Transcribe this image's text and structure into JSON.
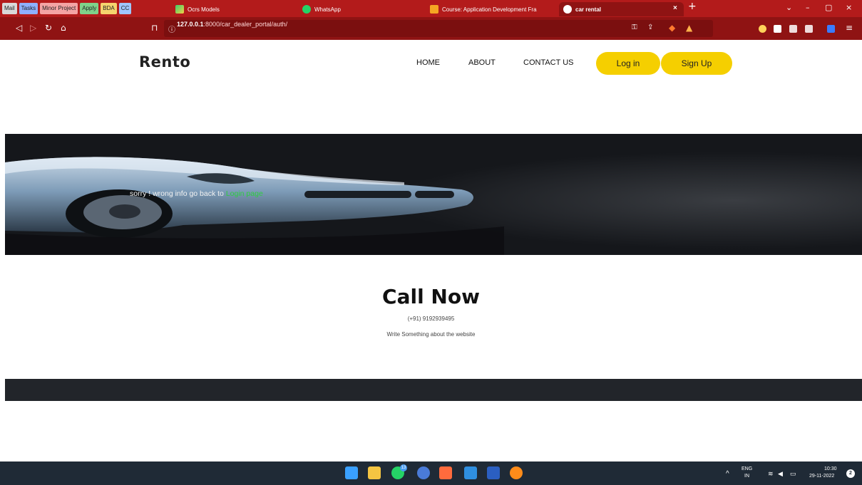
{
  "browser": {
    "bookmarks": [
      {
        "label": "Mail",
        "color": "#d9d9d9"
      },
      {
        "label": "Tasks",
        "color": "#8fb0ff"
      },
      {
        "label": "Minor Project",
        "color": "#f4a4a4"
      },
      {
        "label": "Apply",
        "color": "#7fd28a"
      },
      {
        "label": "BDA",
        "color": "#f5d46e"
      },
      {
        "label": "CC",
        "color": "#9fc6ff"
      }
    ],
    "tabs": [
      {
        "title": "Ocrs Models"
      },
      {
        "title": "WhatsApp"
      },
      {
        "title": "Course: Application Development Fra"
      },
      {
        "title": "car rental"
      }
    ],
    "url_host": "127.0.0.1",
    "url_path": ":8000/car_dealer_portal/auth/"
  },
  "site": {
    "logo": "Rento",
    "nav": [
      "HOME",
      "ABOUT",
      "CONTACT US"
    ],
    "login_label": "Log in",
    "signup_label": "Sign Up",
    "accent_color": "#f5cf00",
    "hero_message": "sorry ! wrong info go back to ",
    "hero_link": "Login page",
    "call_title": "Call Now",
    "call_phone": "(+91) 9192939495",
    "call_desc": "Write Something about the website"
  },
  "taskbar": {
    "lang_top": "ENG",
    "lang_bottom": "IN",
    "time": "10:30",
    "date": "29-11-2022",
    "whatsapp_badge": "13",
    "notification_count": "2"
  }
}
